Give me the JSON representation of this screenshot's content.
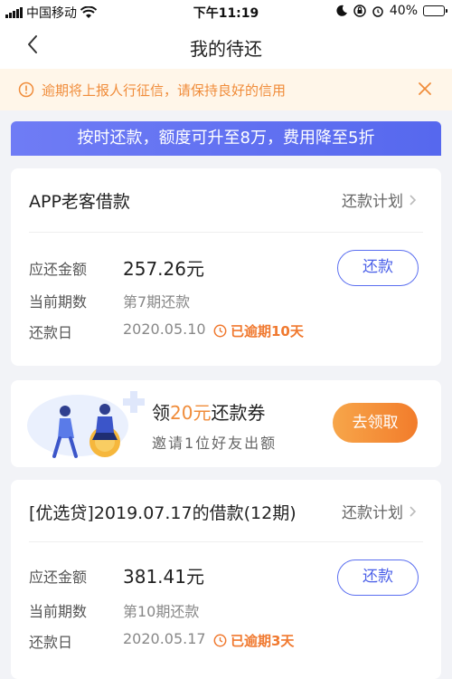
{
  "status_bar": {
    "carrier": "中国移动",
    "time": "下午11:19",
    "battery": "40%",
    "battery_level": 0.4
  },
  "nav": {
    "title": "我的待还"
  },
  "notice": {
    "text": "逾期将上报人行征信，请保持良好的信用"
  },
  "promo": {
    "text": "按时还款，额度可升至8万，费用降至5折"
  },
  "loans": [
    {
      "title": "APP老客借款",
      "plan_label": "还款计划",
      "amount_label": "应还金额",
      "amount": "257.26元",
      "period_label": "当前期数",
      "period": "第7期还款",
      "date_label": "还款日",
      "date": "2020.05.10",
      "overdue": "已逾期10天",
      "repay_label": "还款"
    },
    {
      "title": "[优选贷]2019.07.17的借款(12期)",
      "plan_label": "还款计划",
      "amount_label": "应还金额",
      "amount": "381.41元",
      "period_label": "当前期数",
      "period": "第10期还款",
      "date_label": "还款日",
      "date": "2020.05.17",
      "overdue": "已逾期3天",
      "repay_label": "还款"
    }
  ],
  "coupon": {
    "prefix": "领",
    "highlight": "20元",
    "suffix": "还款券",
    "subtitle": "邀请1位好友出额",
    "button_label": "去领取"
  },
  "colors": {
    "accent_blue": "#5668ee",
    "warning_orange": "#f08c3a"
  }
}
